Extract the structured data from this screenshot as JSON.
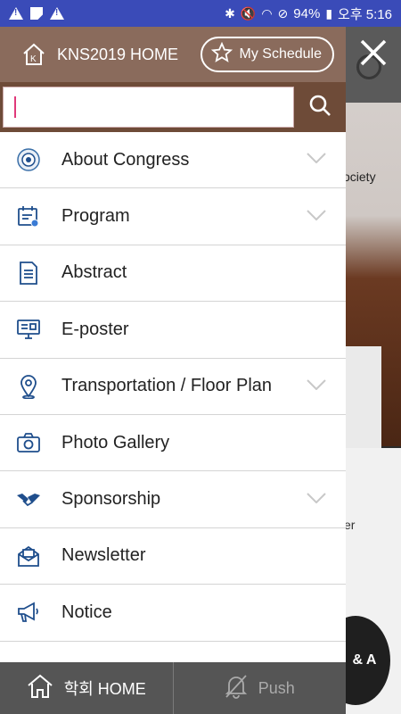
{
  "status_bar": {
    "battery": "94%",
    "time": "오후 5:16"
  },
  "header": {
    "home_label": "KNS2019 HOME",
    "schedule_label": "My Schedule"
  },
  "search": {
    "value": ""
  },
  "menu": {
    "items": [
      {
        "label": "About Congress",
        "icon": "congress-logo-icon",
        "expandable": true
      },
      {
        "label": "Program",
        "icon": "calendar-check-icon",
        "expandable": true
      },
      {
        "label": "Abstract",
        "icon": "document-icon",
        "expandable": false
      },
      {
        "label": "E-poster",
        "icon": "monitor-icon",
        "expandable": false
      },
      {
        "label": "Transportation / Floor Plan",
        "icon": "map-pin-icon",
        "expandable": true
      },
      {
        "label": "Photo Gallery",
        "icon": "camera-icon",
        "expandable": false
      },
      {
        "label": "Sponsorship",
        "icon": "handshake-icon",
        "expandable": true
      },
      {
        "label": "Newsletter",
        "icon": "envelope-icon",
        "expandable": false
      },
      {
        "label": "Notice",
        "icon": "megaphone-icon",
        "expandable": false
      }
    ]
  },
  "bottom_bar": {
    "home_label": "학회 HOME",
    "push_label": "Push"
  },
  "background": {
    "text1": "ociety",
    "text2": "er",
    "qa_label": "& A"
  },
  "colors": {
    "status_bar": "#3a4bb8",
    "drawer_header": "#8a6b5c",
    "search_row": "#6e4b38",
    "icon_blue": "#1f4e8c",
    "bottom_bar": "#555555"
  }
}
